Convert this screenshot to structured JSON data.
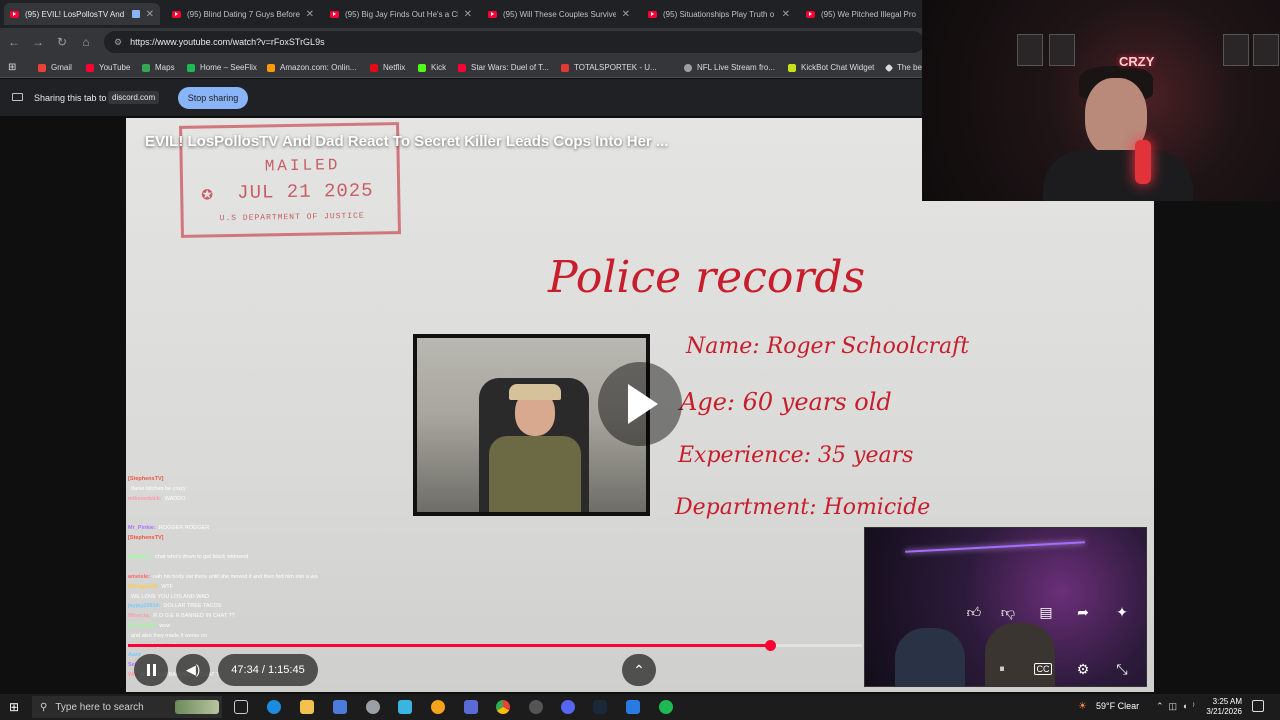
{
  "browser": {
    "tabs": [
      {
        "label": "(95) EVIL! LosPollosTV And",
        "active": true
      },
      {
        "label": "(95) Blind Dating 7 Guys Before",
        "active": false
      },
      {
        "label": "(95) Big Jay Finds Out He's a Cl",
        "active": false
      },
      {
        "label": "(95) Will These Couples Survive",
        "active": false
      },
      {
        "label": "(95) Situationships Play Truth o",
        "active": false
      },
      {
        "label": "(95) We Pitched Illegal Produ",
        "active": false
      }
    ],
    "url": "https://www.youtube.com/watch?v=rFoxSTrGL9s",
    "bookmarks": [
      {
        "label": "Gmail",
        "color": "#ea4335"
      },
      {
        "label": "YouTube",
        "color": "#ff0033"
      },
      {
        "label": "Maps",
        "color": "#34a853"
      },
      {
        "label": "Home – SeeFlix",
        "color": "#1db954"
      },
      {
        "label": "Amazon.com: Onlin...",
        "color": "#ff9900"
      },
      {
        "label": "Netflix",
        "color": "#e50914"
      },
      {
        "label": "Kick",
        "color": "#53fc18"
      },
      {
        "label": "Star Wars: Duel of T...",
        "color": "#ff0033"
      },
      {
        "label": "TOTALSPORTEK - U...",
        "color": "#e53935"
      },
      {
        "label": "NFL Live Stream fro...",
        "color": "#9aa0a6"
      },
      {
        "label": "KickBot Chat Widget",
        "color": "#c6e21c"
      },
      {
        "label": "The be",
        "color": "#dadce0"
      }
    ]
  },
  "sharing": {
    "text": "Sharing this tab to",
    "domain": "discord.com",
    "stop_label": "Stop sharing"
  },
  "video": {
    "title": "EVIL! LosPollosTV And Dad React To Secret Killer Leads Cops Into Her ...",
    "stamp": {
      "line1": "MAILED",
      "line2": "JUL 21 2025",
      "line3": "U.S DEPARTMENT OF JUSTICE"
    },
    "records": {
      "title": "Police records",
      "name": "Name: Roger Schoolcraft",
      "age": "Age: 60 years old",
      "experience": "Experience: 35 years",
      "department": "Department: Homicide"
    },
    "time": "47:34 / 1:15:45",
    "progress_fraction": 0.875
  },
  "chat": [
    {
      "user": "[StephensTV]",
      "msg": "",
      "color": "#e54"
    },
    {
      "user": "",
      "msg": "these bitches be crazy",
      "color": "#7cf"
    },
    {
      "user": "mikeontkick:",
      "msg": "WADDO",
      "color": "#f9a"
    },
    {
      "user": "",
      "msg": "",
      "color": "#fc4"
    },
    {
      "user": "",
      "msg": "",
      "color": "#fc4"
    },
    {
      "user": "Mr_Pinkie:",
      "msg": "ROGGER ROGGER",
      "color": "#a7f"
    },
    {
      "user": "[StephensTV]",
      "msg": "",
      "color": "#e54"
    },
    {
      "user": "",
      "msg": "",
      "color": "#7cf"
    },
    {
      "user": "BigBoss:",
      "msg": "chat who's down to get black widowed",
      "color": "#9f9"
    },
    {
      "user": "",
      "msg": "",
      "color": "#f9a"
    },
    {
      "user": "ameisle:",
      "msg": "nah his body sat there until she moved it and then fed him into a wood chipper",
      "color": "#f66"
    },
    {
      "user": "Wisegay78:",
      "msg": "WTF",
      "color": "#fc4"
    },
    {
      "user": "",
      "msg": "WE LOVE YOU LOS AND WAD",
      "color": "#a7f"
    },
    {
      "user": "jayjay20914:",
      "msg": "DOLLAR TREE TACOS",
      "color": "#7cf"
    },
    {
      "user": "Wisecia:",
      "msg": "R O G E R BANNED IN CHAT ??",
      "color": "#f9a"
    },
    {
      "user": "MrTrololol:",
      "msg": "wow",
      "color": "#9f9"
    },
    {
      "user": "",
      "msg": "and also they made it worse no",
      "color": "#f66"
    },
    {
      "user": "",
      "msg": "I have a log born for",
      "color": "#fc4"
    },
    {
      "user": "Auro",
      "msg": "",
      "color": "#7cf"
    },
    {
      "user": "Sel",
      "msg": "",
      "color": "#a7f"
    },
    {
      "user": "Wis",
      "msg": "R O G E R BANNED IN CHAT ??",
      "color": "#f9a"
    }
  ],
  "webcam": {
    "sign": "CRZY"
  },
  "taskbar": {
    "search_placeholder": "Type here to search",
    "weather": "59°F  Clear",
    "time": "3:25 AM",
    "date": "3/21/2026"
  },
  "icons": {
    "back": "arrow-left-icon",
    "forward": "arrow-right-icon",
    "reload": "reload-icon",
    "home": "home-icon",
    "play": "play-icon",
    "pause": "pause-icon",
    "volume": "volume-icon",
    "expand": "chevron-up-icon"
  }
}
